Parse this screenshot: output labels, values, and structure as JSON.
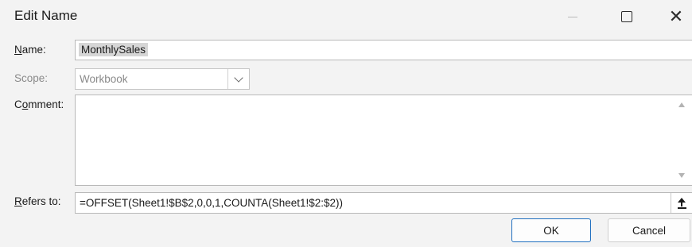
{
  "window": {
    "title": "Edit Name",
    "controls": {
      "minimize": "minimize-icon",
      "maximize": "maximize-icon",
      "close": "close-icon",
      "close_glyph": "✕"
    }
  },
  "form": {
    "name": {
      "label_prefix": "",
      "label_accel": "N",
      "label_rest": "ame:",
      "value": "MonthlySales"
    },
    "scope": {
      "label": "Scope:",
      "value": "Workbook"
    },
    "comment": {
      "label_prefix": "C",
      "label_accel": "o",
      "label_rest": "mment:",
      "value": ""
    },
    "refers_to": {
      "label_prefix": "",
      "label_accel": "R",
      "label_rest": "efers to:",
      "value": "=OFFSET(Sheet1!$B$2,0,0,1,COUNTA(Sheet1!$2:$2))"
    }
  },
  "buttons": {
    "ok": "OK",
    "cancel": "Cancel"
  },
  "colors": {
    "background": "#f3f3f3",
    "accent": "#1f6fbf",
    "selection": "#d6d6d6"
  }
}
